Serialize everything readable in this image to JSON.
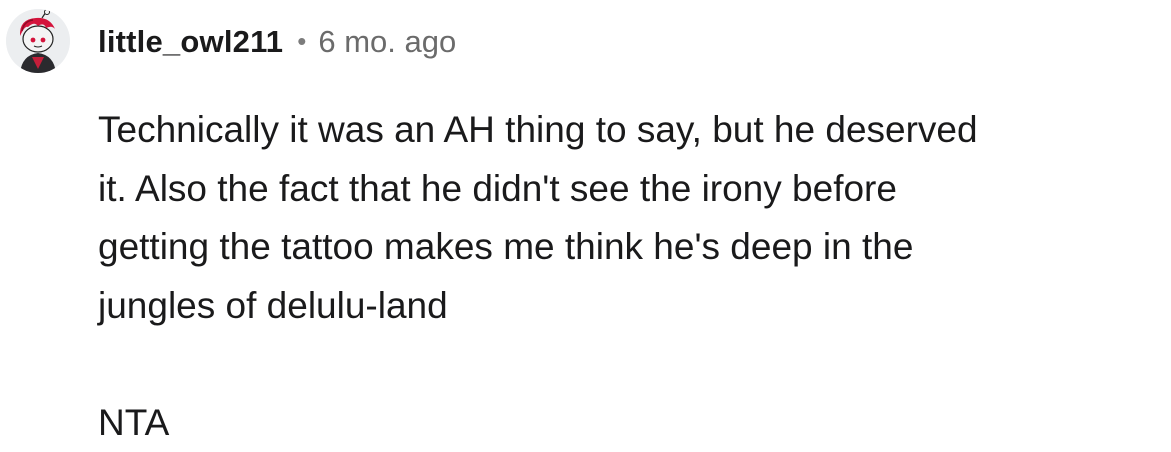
{
  "comment": {
    "author": "little_owl211",
    "separator": "•",
    "timestamp": "6 mo. ago",
    "avatar_icon": "user-avatar-icon",
    "paragraphs": [
      "Technically it was an AH thing to say, but he deserved\nit. Also the fact that he didn't see the irony before\ngetting the tattoo makes me think he's deep in the\njungles of delulu-land",
      "NTA"
    ]
  }
}
